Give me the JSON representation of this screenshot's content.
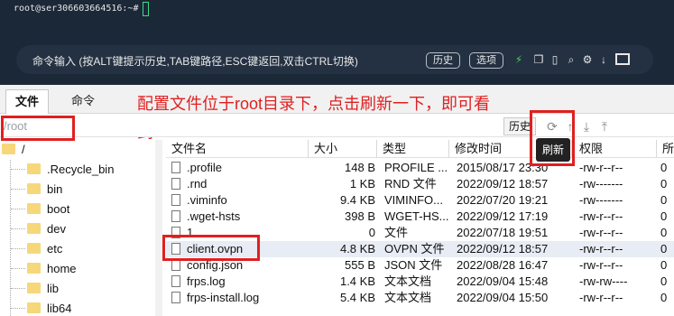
{
  "terminal": {
    "prompt": "root@ser306603664516:~#",
    "command_placeholder": "命令输入 (按ALT键提示历史,TAB键路径,ESC键返回,双击CTRL切换)",
    "history_label": "历史",
    "options_label": "选项",
    "icons": [
      "lightning-icon",
      "copy-icon",
      "file-icon",
      "search-icon",
      "gear-icon",
      "download-icon",
      "window-icon"
    ]
  },
  "tabs": [
    {
      "label": "文件",
      "active": true
    },
    {
      "label": "命令",
      "active": false
    }
  ],
  "annotation": {
    "line1": "配置文件位于root目录下，点击刷新一下，即可看",
    "line2": "到"
  },
  "pathbar": {
    "path_value": "/root",
    "history_label": "历史",
    "tooltip": "刷新",
    "icons": [
      "refresh-icon",
      "up-icon",
      "download-icon",
      "upload-icon"
    ]
  },
  "tree": {
    "root": "/",
    "items": [
      ".Recycle_bin",
      "bin",
      "boot",
      "dev",
      "etc",
      "home",
      "lib",
      "lib64"
    ]
  },
  "table": {
    "columns": [
      "文件名",
      "大小",
      "类型",
      "修改时间",
      "",
      "权限",
      "所"
    ],
    "rows": [
      {
        "name": ".profile",
        "size": "148 B",
        "type": "PROFILE ...",
        "modified": "2015/08/17 23:30",
        "perm": "-rw-r--r--",
        "owner": "0"
      },
      {
        "name": ".rnd",
        "size": "1 KB",
        "type": "RND 文件",
        "modified": "2022/09/12 18:57",
        "perm": "-rw-------",
        "owner": "0"
      },
      {
        "name": ".viminfo",
        "size": "9.4 KB",
        "type": "VIMINFO...",
        "modified": "2022/07/20 19:21",
        "perm": "-rw-------",
        "owner": "0"
      },
      {
        "name": ".wget-hsts",
        "size": "398 B",
        "type": "WGET-HS...",
        "modified": "2022/09/12 17:19",
        "perm": "-rw-r--r--",
        "owner": "0"
      },
      {
        "name": "1",
        "size": "0",
        "type": "文件",
        "modified": "2022/07/18 19:51",
        "perm": "-rw-r--r--",
        "owner": "0"
      },
      {
        "name": "client.ovpn",
        "size": "4.8 KB",
        "type": "OVPN 文件",
        "modified": "2022/09/12 18:57",
        "perm": "-rw-r--r--",
        "owner": "0"
      },
      {
        "name": "config.json",
        "size": "555 B",
        "type": "JSON 文件",
        "modified": "2022/08/28 16:47",
        "perm": "-rw-r--r--",
        "owner": "0"
      },
      {
        "name": "frps.log",
        "size": "1.4 KB",
        "type": "文本文档",
        "modified": "2022/09/04 15:48",
        "perm": "-rw-rw----",
        "owner": "0"
      },
      {
        "name": "frps-install.log",
        "size": "5.4 KB",
        "type": "文本文档",
        "modified": "2022/09/04 15:50",
        "perm": "-rw-r--r--",
        "owner": "0"
      }
    ]
  },
  "colors": {
    "annotation": "#e02020",
    "terminal_bg": "#1b2838",
    "folder": "#f6d77a"
  }
}
